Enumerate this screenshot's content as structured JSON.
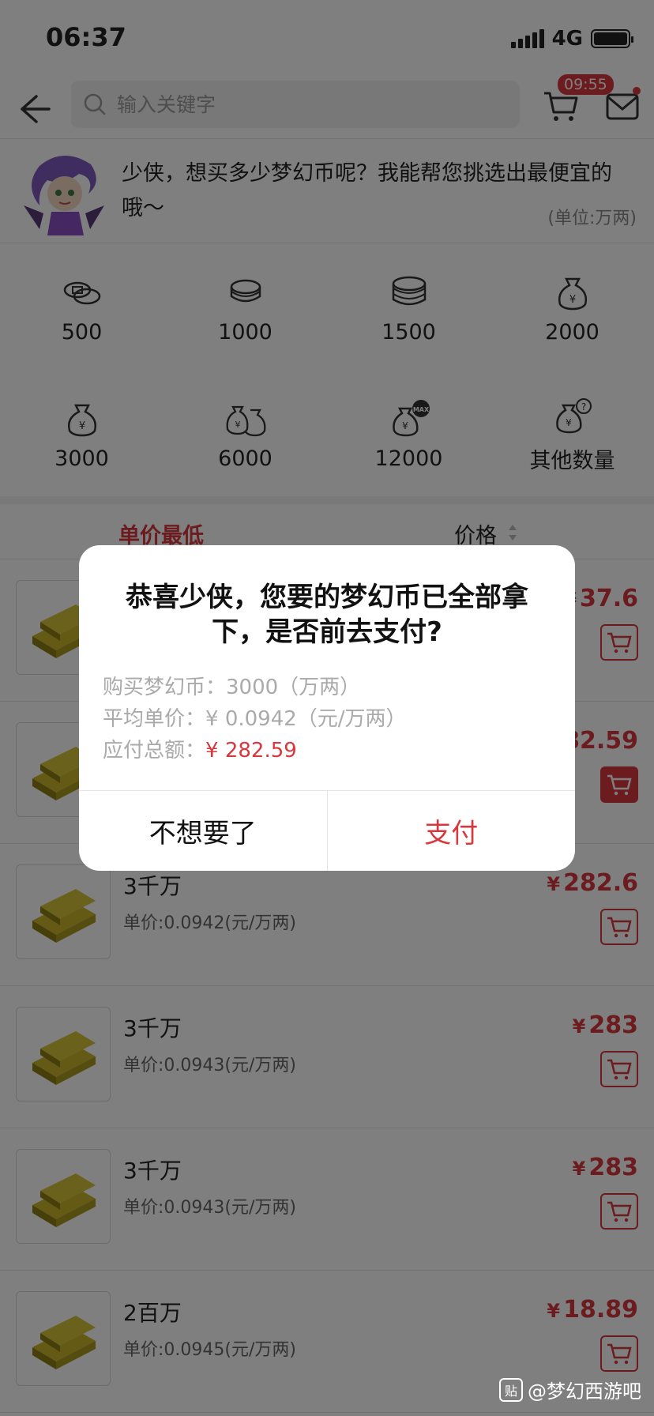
{
  "status_bar": {
    "time": "06:37",
    "network": "4G"
  },
  "header": {
    "search_placeholder": "输入关键字",
    "timer_badge": "09:55"
  },
  "promo": {
    "text": "少侠，想买多少梦幻币呢？我能帮您挑选出最便宜的哦～",
    "unit_note": "(单位:万两)"
  },
  "quantities": [
    {
      "label": "500",
      "icon": "coins-icon"
    },
    {
      "label": "1000",
      "icon": "coins-icon"
    },
    {
      "label": "1500",
      "icon": "coins-icon"
    },
    {
      "label": "2000",
      "icon": "money-bag-icon"
    },
    {
      "label": "3000",
      "icon": "money-bag-icon"
    },
    {
      "label": "6000",
      "icon": "money-bags-icon"
    },
    {
      "label": "12000",
      "icon": "money-bag-max-icon"
    },
    {
      "label": "其他数量",
      "icon": "money-bag-question-icon"
    }
  ],
  "sort": {
    "lowest_unit_price": "单价最低",
    "price": "价格"
  },
  "listings": [
    {
      "amount": "",
      "unit_price": "",
      "price": "37.6",
      "currency": "¥"
    },
    {
      "amount": "",
      "unit_price": "",
      "price": "82.59",
      "currency": "¥"
    },
    {
      "amount": "3千万",
      "unit_price": "单价:0.0942(元/万两)",
      "price": "282.6",
      "currency": "¥"
    },
    {
      "amount": "3千万",
      "unit_price": "单价:0.0943(元/万两)",
      "price": "283",
      "currency": "¥"
    },
    {
      "amount": "3千万",
      "unit_price": "单价:0.0943(元/万两)",
      "price": "283",
      "currency": "¥"
    },
    {
      "amount": "2百万",
      "unit_price": "单价:0.0945(元/万两)",
      "price": "18.89",
      "currency": "¥"
    }
  ],
  "dialog": {
    "title": "恭喜少侠，您要的梦幻币已全部拿下，是否前去支付?",
    "buy_label": "购买梦幻币：",
    "buy_value": "3000（万两）",
    "avg_label": "平均单价：",
    "avg_value": "¥ 0.0942（元/万两）",
    "total_label": "应付总额：",
    "total_value": "¥ 282.59",
    "cancel": "不想要了",
    "pay": "支付"
  },
  "watermark": {
    "text": "@梦幻西游吧",
    "logo": "贴"
  },
  "colors": {
    "accent": "#d9363e",
    "text": "#222222",
    "muted": "#999999"
  }
}
